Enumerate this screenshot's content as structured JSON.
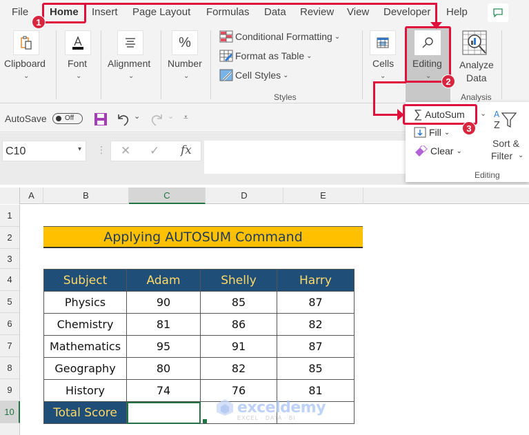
{
  "menu": {
    "items": [
      "File",
      "Home",
      "Insert",
      "Page Layout",
      "Formulas",
      "Data",
      "Review",
      "View",
      "Developer",
      "Help"
    ],
    "active": "Home"
  },
  "ribbon": {
    "clipboard": "Clipboard",
    "font": "Font",
    "alignment": "Alignment",
    "number": "Number",
    "conditional_formatting": "Conditional Formatting",
    "format_as_table": "Format as Table",
    "cell_styles": "Cell Styles",
    "styles_group": "Styles",
    "cells": "Cells",
    "editing": "Editing",
    "analyze_data_line1": "Analyze",
    "analyze_data_line2": "Data",
    "analysis_group": "Analysis"
  },
  "qat": {
    "autosave_label": "AutoSave",
    "autosave_state": "Off"
  },
  "formula_bar": {
    "name_box": "C10",
    "fx": "fx",
    "value": ""
  },
  "editing_panel": {
    "autosum": "AutoSum",
    "fill": "Fill",
    "clear": "Clear",
    "sort_filter_line1": "Sort &",
    "sort_filter_line2": "Filter",
    "group": "Editing"
  },
  "sheet": {
    "columns": [
      "A",
      "B",
      "C",
      "D",
      "E"
    ],
    "selected_column": "C",
    "rows": [
      "1",
      "2",
      "3",
      "4",
      "5",
      "6",
      "7",
      "8",
      "9",
      "10"
    ],
    "selected_row": "10",
    "title": "Applying AUTOSUM Command",
    "table": {
      "headers": [
        "Subject",
        "Adam",
        "Shelly",
        "Harry"
      ],
      "rows": [
        [
          "Physics",
          "90",
          "85",
          "87"
        ],
        [
          "Chemistry",
          "81",
          "86",
          "82"
        ],
        [
          "Mathematics",
          "95",
          "91",
          "87"
        ],
        [
          "Geography",
          "80",
          "82",
          "85"
        ],
        [
          "History",
          "74",
          "76",
          "81"
        ]
      ],
      "total_label": "Total Score",
      "totals": [
        "",
        "",
        ""
      ]
    }
  },
  "watermark": {
    "name": "exceldemy",
    "tagline": "EXCEL · DATA · BI"
  },
  "annotations": {
    "step1": "1",
    "step2": "2",
    "step3": "3",
    "color": "#e0103d"
  }
}
